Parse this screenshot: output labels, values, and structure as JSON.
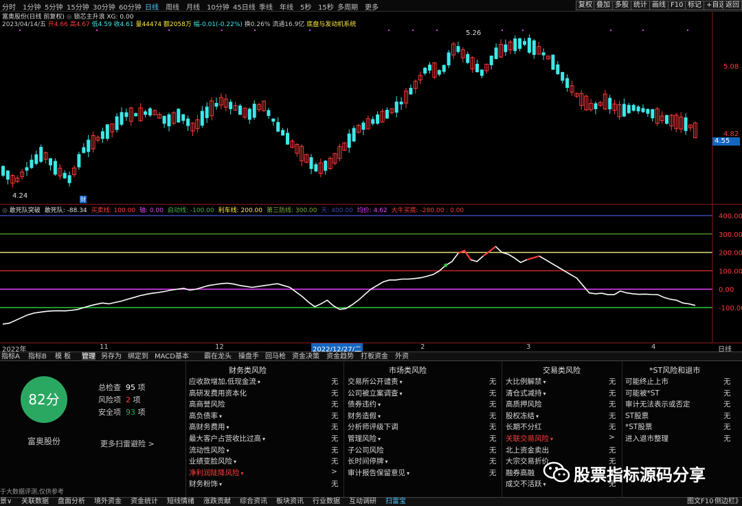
{
  "toolbar": {
    "periods": [
      "分时",
      "1分钟",
      "5分钟",
      "15分钟",
      "30分钟",
      "60分钟",
      "日线",
      "周线",
      "月线",
      "10分钟",
      "45日线",
      "季线",
      "年线",
      "5秒",
      "15秒",
      "多周期",
      "更多"
    ],
    "active_period": "日线",
    "right_buttons": [
      "复权",
      "叠加",
      "多股",
      "统计",
      "画线",
      "F10",
      "标记",
      "+自选",
      "返回"
    ]
  },
  "stock": {
    "title": "富奥股份(日线 前复权)",
    "indicator_name": "锁芯主升浪",
    "xg": "XG: 0.00",
    "date": "2023/04/14/五",
    "open": "开4.66",
    "high": "高4.67",
    "low": "低4.59",
    "close": "收4.61",
    "volume": "量44474",
    "amount": "额2058万",
    "change": "幅-0.01(-0.22%)",
    "turnover": "换0.26%",
    "float": "流通16.9亿",
    "concept": "底盘与发动机系统"
  },
  "price_axis": {
    "labels": [
      "5.08",
      "4.82"
    ],
    "current_price": "4.55",
    "high_marker": "5.26",
    "low_marker": "4.24",
    "event_marker": "财"
  },
  "indicator": {
    "name": "敢死队突破",
    "fields": [
      {
        "label": "敢死队: -88.34",
        "color": "#e0e0e0"
      },
      {
        "label": "买卖线: 100.00",
        "color": "#ff3b3b"
      },
      {
        "label": "轴: 0.00",
        "color": "#e040fb"
      },
      {
        "label": "启动线: -100.00",
        "color": "#4caf50"
      },
      {
        "label": "利车线: 200.00",
        "color": "#ffeb3b"
      },
      {
        "label": "第三防线: 300.00",
        "color": "#7cb342"
      },
      {
        "label": "天: 400.00",
        "color": "#3949ab"
      },
      {
        "label": "均价: 4.62",
        "color": "#e040fb"
      },
      {
        "label": "大牛买底: -280.00 : 0.00",
        "color": "#ff3b3b"
      }
    ],
    "axis_labels": [
      "400.00",
      "300.00",
      "200.00",
      "100.00",
      "0.00",
      "-100.00"
    ],
    "levels": [
      {
        "value": 400,
        "color": "#3949ab"
      },
      {
        "value": 300,
        "color": "#4a8a2a"
      },
      {
        "value": 200,
        "color": "#e8e27a"
      },
      {
        "value": 100,
        "color": "#c62828"
      },
      {
        "value": 0,
        "color": "#e040fb"
      },
      {
        "value": -100,
        "color": "#2ecc40"
      }
    ],
    "series": [
      -190,
      -185,
      -170,
      -155,
      -140,
      -130,
      -125,
      -120,
      -118,
      -117,
      -118,
      -115,
      -110,
      -100,
      -90,
      -82,
      -75,
      -80,
      -72,
      -65,
      -55,
      -45,
      -35,
      -28,
      -22,
      -18,
      -12,
      -5,
      0,
      5,
      -5,
      0,
      10,
      20,
      25,
      30,
      33,
      28,
      20,
      15,
      10,
      15,
      20,
      25,
      30,
      20,
      10,
      -15,
      -40,
      -70,
      -95,
      -80,
      -60,
      -90,
      -110,
      -105,
      -85,
      -60,
      -30,
      0,
      20,
      40,
      50,
      50,
      55,
      55,
      58,
      62,
      70,
      80,
      100,
      130,
      150,
      195,
      210,
      160,
      150,
      180,
      205,
      232,
      200,
      190,
      170,
      145,
      160,
      170,
      180,
      160,
      140,
      120,
      100,
      80,
      60,
      20,
      -20,
      -25,
      -22,
      -30,
      -30,
      -10,
      -20,
      -25,
      -28,
      -27,
      -29,
      -30,
      -45,
      -55,
      -60,
      -75,
      -80,
      -88
    ],
    "date_labels": [
      "2022年",
      "11",
      "12",
      "2022/12/27/二",
      "2",
      "3",
      "4"
    ],
    "period_label": "日线"
  },
  "tabs": {
    "items": [
      "指标A",
      "指标B",
      "模 板",
      "管理",
      "另存为",
      "绑定到",
      "MACD基本",
      "霸在龙头",
      "操盘手",
      "回马枪",
      "资金决策",
      "资金趋势",
      "打板资金",
      "外资"
    ],
    "selected": "管理"
  },
  "risk": {
    "score": "82分",
    "total_label": "总检查",
    "total_count": "95",
    "risk_label": "风险项",
    "risk_count": "2",
    "safe_label": "安全项",
    "safe_count": "93",
    "unit": "项",
    "company": "富奥股份",
    "more_link": "更多扫雷避险 >",
    "footnote": "于大数据评测,仅供参考",
    "columns": [
      {
        "title": "财务类风险",
        "items": [
          {
            "label": "应收款增加,低现金流",
            "arrow": "▾",
            "value": "无"
          },
          {
            "label": "高研发费用资本化",
            "arrow": "",
            "value": "无"
          },
          {
            "label": "高商誉风险",
            "arrow": "",
            "value": "无"
          },
          {
            "label": "高负债率",
            "arrow": "▾",
            "value": "无"
          },
          {
            "label": "高财务费用",
            "arrow": "▾",
            "value": "无"
          },
          {
            "label": "最大客户占营收比过高",
            "arrow": "▾",
            "value": "无"
          },
          {
            "label": "流动性风险",
            "arrow": "▾",
            "value": "无"
          },
          {
            "label": "业绩变脸风险",
            "arrow": "▾",
            "value": "无"
          },
          {
            "label": "净利润陡降风险",
            "arrow": "▾",
            "value": ">",
            "red": true
          },
          {
            "label": "财务粉饰",
            "arrow": "▾",
            "value": "无"
          }
        ]
      },
      {
        "title": "市场类风险",
        "items": [
          {
            "label": "交易所公开谴责",
            "arrow": "▾",
            "value": "无"
          },
          {
            "label": "公司被立案调查",
            "arrow": "▾",
            "value": "无"
          },
          {
            "label": "债券违约",
            "arrow": "▾",
            "value": "无"
          },
          {
            "label": "财务造假",
            "arrow": "▾",
            "value": "无"
          },
          {
            "label": "分析师评级下调",
            "arrow": "",
            "value": "无"
          },
          {
            "label": "管理风险",
            "arrow": "▾",
            "value": "无"
          },
          {
            "label": "子公司风险",
            "arrow": "",
            "value": "无"
          },
          {
            "label": "长时间停牌",
            "arrow": "▾",
            "value": "无"
          },
          {
            "label": "审计报告保留意见",
            "arrow": "▾",
            "value": "无"
          }
        ]
      },
      {
        "title": "交易类风险",
        "items": [
          {
            "label": "大比例解禁",
            "arrow": "▾",
            "value": "无"
          },
          {
            "label": "清仓式减持",
            "arrow": "▾",
            "value": "无"
          },
          {
            "label": "高质押风险",
            "arrow": "",
            "value": "无"
          },
          {
            "label": "股权冻结",
            "arrow": "▾",
            "value": "无"
          },
          {
            "label": "长期不分红",
            "arrow": "",
            "value": "无"
          },
          {
            "label": "关联交易风险",
            "arrow": "▾",
            "value": ">",
            "red": true
          },
          {
            "label": "北上资金卖出",
            "arrow": "",
            "value": "无"
          },
          {
            "label": "大宗交易折价",
            "arrow": "",
            "value": "无"
          },
          {
            "label": "融券高融",
            "arrow": "",
            "value": "无"
          },
          {
            "label": "成交不活跃",
            "arrow": "▾",
            "value": "无"
          }
        ]
      },
      {
        "title": "*ST风险和退市",
        "items": [
          {
            "label": "可能终止上市",
            "arrow": "",
            "value": "无"
          },
          {
            "label": "可能被*ST",
            "arrow": "",
            "value": "无"
          },
          {
            "label": "审计无法表示或否定",
            "arrow": "",
            "value": "无"
          },
          {
            "label": "ST股票",
            "arrow": "",
            "value": "无"
          },
          {
            "label": "*ST股票",
            "arrow": "",
            "value": "无"
          },
          {
            "label": "进入退市整理",
            "arrow": "",
            "value": "无"
          }
        ]
      }
    ]
  },
  "statusbar": {
    "items": [
      "景∨",
      "关联数据",
      "盘面分析",
      "境外资金",
      "资金统计",
      "短线情绪",
      "涨跌贡献",
      "综合资讯",
      "板块资讯",
      "行业数据",
      "互动调研",
      "扫雷宝"
    ],
    "selected": "扫雷宝",
    "right": "图文F10",
    "right2": "侧边栏》"
  },
  "watermark": {
    "text": "股票指标源码分享"
  },
  "colors": {
    "up": "#ff3b3b",
    "down": "#3ee8e8",
    "score_bg": "#2aa862"
  }
}
